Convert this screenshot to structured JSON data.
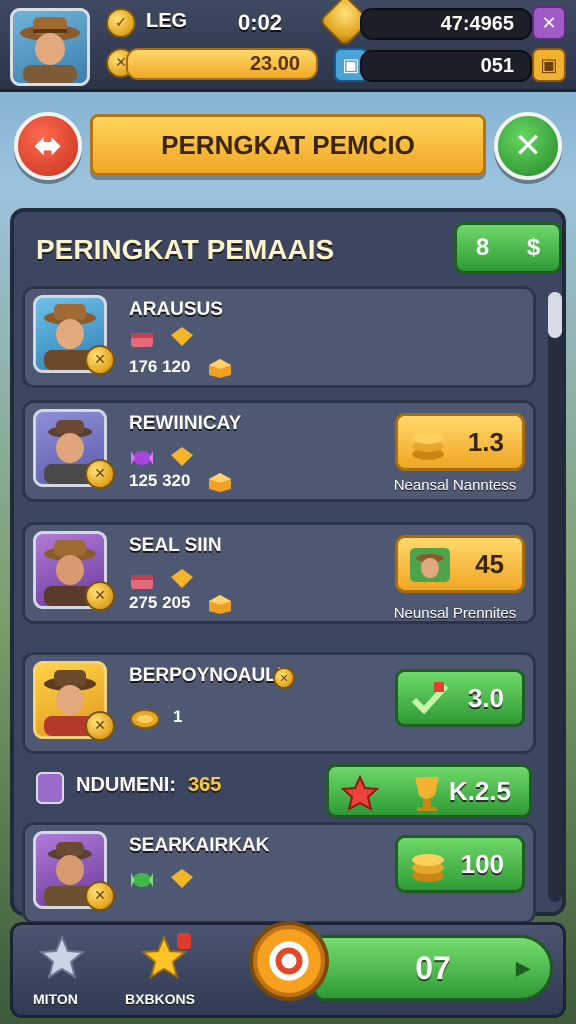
{
  "hud": {
    "level_label": "LEG",
    "timer": "0:02",
    "currency_top": "47:4965",
    "currency_gold": "23.00",
    "currency_dark": "051"
  },
  "banner": {
    "title": "PERNGKAT PEMCIO"
  },
  "panel": {
    "title": "PERINGKAT PEMAAIS",
    "badge_value": "8",
    "badge_symbol": "$"
  },
  "rows": [
    {
      "name": "ARAUSUS",
      "stat": "176 120"
    },
    {
      "name": "REWIINICAY",
      "stat": "125 320",
      "reward": "1.3",
      "caption": "Neansal Nanntess"
    },
    {
      "name": "SEAL SIIN",
      "stat": "275 205",
      "reward": "45",
      "caption": "Neunsal Prennites"
    },
    {
      "name": "BERPOYNOAULI",
      "stat": "1",
      "reward": "3.0"
    },
    {
      "name": "NDUMENI:",
      "highlight": "365",
      "reward": "K.2.5"
    },
    {
      "name": "SEARKAIRKAK",
      "reward": "100"
    }
  ],
  "bottom": {
    "nav1": "MITON",
    "nav2": "BXBKONS",
    "play": "07"
  },
  "colors": {
    "gold": "#f0a926",
    "green": "#2f9a35",
    "panel": "#3d4660",
    "close_button": "#2fa437",
    "back_button": "#e0402d"
  }
}
